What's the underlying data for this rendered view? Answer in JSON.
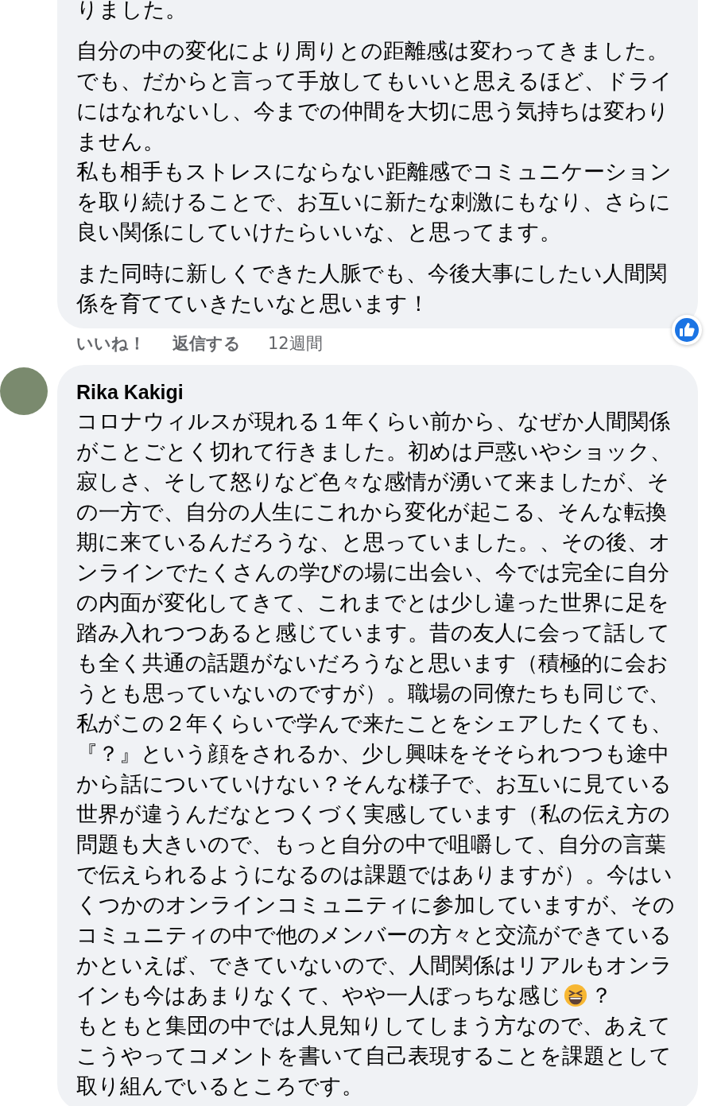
{
  "comments": [
    {
      "paragraphs": [
        {
          "lines": [
            {
              "parts": [
                {
                  "kind": "text",
                  "text": "りました。"
                }
              ]
            }
          ]
        },
        {
          "lines": [
            {
              "parts": [
                {
                  "kind": "text",
                  "text": "自分の中の変化により周りとの距離感は変わってきました。でも、だからと言って手放してもいいと思えるほど、ドライにはなれないし、今までの仲間を大切に思う気持ちは変わりません。"
                }
              ]
            },
            {
              "parts": [
                {
                  "kind": "text",
                  "text": "私も相手もストレスにならない距離感でコミュニケーションを取り続けることで、お互いに新たな刺激にもなり、さらに良い関係にしていけたらいいな、と思ってます。"
                }
              ]
            }
          ]
        },
        {
          "lines": [
            {
              "parts": [
                {
                  "kind": "text",
                  "text": "また同時に新しくできた人脈でも、今後大事にしたい人間関係を育てていきたいなと思います！"
                }
              ]
            }
          ]
        }
      ],
      "liked": true,
      "actions": {
        "like": "いいね！",
        "reply": "返信する",
        "time": "12週間"
      }
    },
    {
      "avatar": true,
      "author": "Rika Kakigi",
      "paragraphs": [
        {
          "lines": [
            {
              "parts": [
                {
                  "kind": "text",
                  "text": "コロナウィルスが現れる１年くらい前から、なぜか人間関係がことごとく切れて行きました。初めは戸惑いやショック、寂しさ、そして怒りなど色々な感情が湧いて来ましたが、その一方で、自分の人生にこれから変化が起こる、そんな転換期に来ているんだろうな、と思っていました。、その後、オンラインでたくさんの学びの場に出会い、今では完全に自分の内面が変化してきて、これまでとは少し違った世界に足を踏み入れつつあると感じています。昔の友人に会って話しても全く共通の話題がないだろうなと思います（積極的に会おうとも思っていないのですが）。職場の同僚たちも同じで、私がこの２年くらいで学んで来たことをシェアしたくても、『？』という顔をされるか、少し興味をそそられつつも途中から話についていけない？そんな様子で、お互いに見ている世界が違うんだなとつくづく実感しています（私の伝え方の問題も大きいので、もっと自分の中で咀嚼して、自分の言葉で伝えられるようになるのは課題ではありますが）。今はいくつかのオンラインコミュニティに参加していますが、そのコミュニティの中で他のメンバーの方々と交流ができているかといえば、できていないので、人間関係はリアルもオンラ"
                }
              ]
            },
            {
              "parts": [
                {
                  "kind": "text",
                  "text": "インも今はあまりなくて、やや一人ぼっちな感じ"
                },
                {
                  "kind": "emoji"
                },
                {
                  "kind": "text",
                  "text": "？"
                }
              ]
            },
            {
              "parts": [
                {
                  "kind": "text",
                  "text": "もともと集団の中では人見知りしてしまう方なので、あえてこうやってコメントを書いて自己表現することを課題として取り組んでいるところです。"
                }
              ]
            }
          ]
        }
      ]
    }
  ]
}
